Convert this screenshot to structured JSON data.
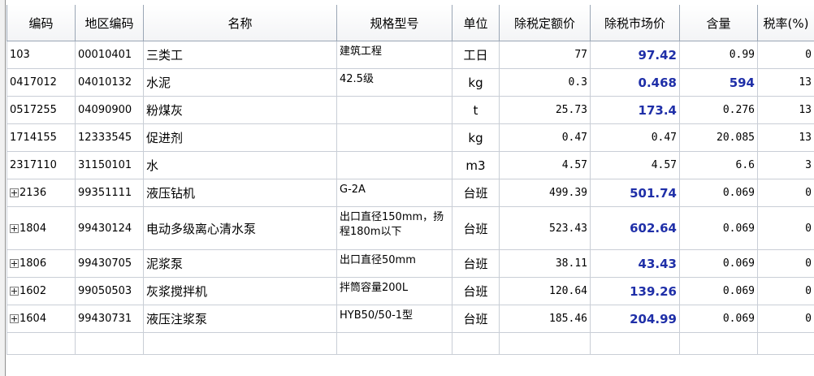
{
  "columns": [
    "编码",
    "地区编码",
    "名称",
    "规格型号",
    "单位",
    "除税定额价",
    "除税市场价",
    "含量",
    "税率(%)"
  ],
  "rows": [
    {
      "code": "103",
      "expandable": false,
      "region": "00010401",
      "name": "三类工",
      "spec": "建筑工程",
      "unit": "工日",
      "base_price": "77",
      "market_price": "97.42",
      "market_hl": true,
      "qty": "0.99",
      "qty_hl": false,
      "tax": "0"
    },
    {
      "code": "0417012",
      "expandable": false,
      "region": "04010132",
      "name": "水泥",
      "spec": "42.5级",
      "unit": "kg",
      "base_price": "0.3",
      "market_price": "0.468",
      "market_hl": true,
      "qty": "594",
      "qty_hl": true,
      "tax": "13"
    },
    {
      "code": "0517255",
      "expandable": false,
      "region": "04090900",
      "name": "粉煤灰",
      "spec": "",
      "unit": "t",
      "base_price": "25.73",
      "market_price": "173.4",
      "market_hl": true,
      "qty": "0.276",
      "qty_hl": false,
      "tax": "13"
    },
    {
      "code": "1714155",
      "expandable": false,
      "region": "12333545",
      "name": "促进剂",
      "spec": "",
      "unit": "kg",
      "base_price": "0.47",
      "market_price": "0.47",
      "market_hl": false,
      "qty": "20.085",
      "qty_hl": false,
      "tax": "13"
    },
    {
      "code": "2317110",
      "expandable": false,
      "region": "31150101",
      "name": "水",
      "spec": "",
      "unit": "m3",
      "base_price": "4.57",
      "market_price": "4.57",
      "market_hl": false,
      "qty": "6.6",
      "qty_hl": false,
      "tax": "3"
    },
    {
      "code": "2136",
      "expandable": true,
      "region": "99351111",
      "name": "液压钻机",
      "spec": "G-2A",
      "unit": "台班",
      "base_price": "499.39",
      "market_price": "501.74",
      "market_hl": true,
      "qty": "0.069",
      "qty_hl": false,
      "tax": "0"
    },
    {
      "code": "1804",
      "expandable": true,
      "region": "99430124",
      "name": "电动多级离心清水泵",
      "spec": "出口直径150mm，扬程180m以下",
      "unit": "台班",
      "base_price": "523.43",
      "market_price": "602.64",
      "market_hl": true,
      "qty": "0.069",
      "qty_hl": false,
      "tax": "0",
      "tall": true
    },
    {
      "code": "1806",
      "expandable": true,
      "region": "99430705",
      "name": "泥浆泵",
      "spec": "出口直径50mm",
      "unit": "台班",
      "base_price": "38.11",
      "market_price": "43.43",
      "market_hl": true,
      "qty": "0.069",
      "qty_hl": false,
      "tax": "0"
    },
    {
      "code": "1602",
      "expandable": true,
      "region": "99050503",
      "name": "灰浆搅拌机",
      "spec": "拌筒容量200L",
      "unit": "台班",
      "base_price": "120.64",
      "market_price": "139.26",
      "market_hl": true,
      "qty": "0.069",
      "qty_hl": false,
      "tax": "0"
    },
    {
      "code": "1604",
      "expandable": true,
      "region": "99430731",
      "name": "液压注浆泵",
      "spec": "HYB50/50-1型",
      "unit": "台班",
      "base_price": "185.46",
      "market_price": "204.99",
      "market_hl": true,
      "qty": "0.069",
      "qty_hl": false,
      "tax": "0"
    }
  ],
  "colors": {
    "highlight": "#1f2fa8",
    "header_border": "#9aa6b5",
    "cell_border": "#c9ced6"
  }
}
